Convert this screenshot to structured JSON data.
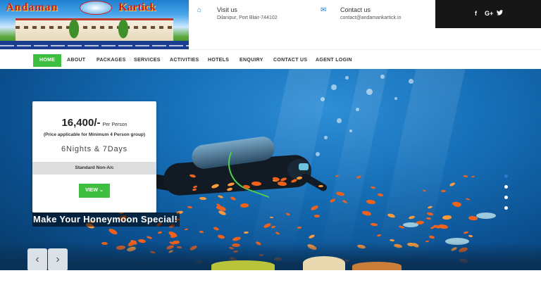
{
  "header": {
    "brand_left": "Andaman",
    "brand_right": "Kartick",
    "visit": {
      "icon": "home-icon",
      "title": "Visit us",
      "value": "Dilanipur, Port Blair-744102"
    },
    "contact": {
      "icon": "envelope-icon",
      "title": "Contact us",
      "value": "contact@andamankartick.in"
    },
    "social": [
      {
        "icon": "facebook-icon",
        "glyph": "f"
      },
      {
        "icon": "google-plus-icon",
        "glyph": "G+"
      },
      {
        "icon": "twitter-icon",
        "glyph": "🐦"
      }
    ]
  },
  "nav": {
    "items": [
      "HOME",
      "ABOUT",
      "PACKAGES",
      "SERVICES",
      "ACTIVITIES",
      "HOTELS",
      "ENQUIRY",
      "CONTACT US",
      "AGENT LOGIN"
    ],
    "active_index": 0
  },
  "hero": {
    "package": {
      "price": "16,400/-",
      "per": "Per Person",
      "note": "(Price applicable for Minimum 4 Person group)",
      "duration": "6Nights & 7Days",
      "type": "Standard Non-A/c",
      "button": "VIEW ⌄"
    },
    "tagline": "Make Your Honeymoon Special!",
    "prev_arrow": "‹",
    "next_arrow": "›",
    "slide_count": 4,
    "active_slide": 0
  },
  "colors": {
    "accent_green": "#3fbf3f",
    "icon_blue": "#1c79c0",
    "social_bar": "#161616"
  }
}
